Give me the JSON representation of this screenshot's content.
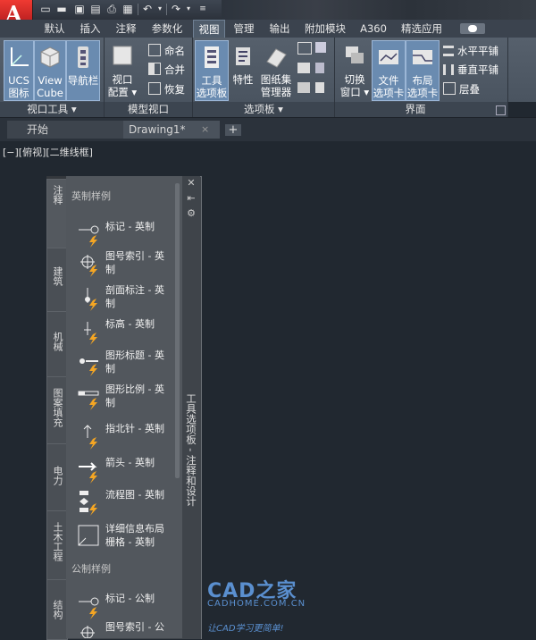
{
  "quick_access": {
    "icons": [
      "new-icon",
      "open-icon",
      "save-icon",
      "saveas-icon",
      "print-icon",
      "undo-icon",
      "redo-icon",
      "customize-icon"
    ]
  },
  "ribbon_tabs": [
    "默认",
    "插入",
    "注释",
    "参数化",
    "视图",
    "管理",
    "输出",
    "附加模块",
    "A360",
    "精选应用"
  ],
  "active_tab": "视图",
  "panels": {
    "viewport_tools": {
      "label": "视口工具",
      "buttons": [
        {
          "line1": "UCS",
          "line2": "图标"
        },
        {
          "line1": "View",
          "line2": "Cube"
        },
        {
          "line1": "导航栏",
          "line2": ""
        }
      ]
    },
    "model_viewports": {
      "label": "模型视口",
      "config_line1": "视口",
      "config_line2": "配置",
      "small": [
        "命名",
        "合并",
        "恢复"
      ]
    },
    "palettes": {
      "label": "选项板",
      "tool_palettes_line1": "工具",
      "tool_palettes_line2": "选项板",
      "properties": "特性",
      "sheetset_line1": "图纸集",
      "sheetset_line2": "管理器"
    },
    "interface": {
      "label": "界面",
      "switch_line1": "切换",
      "switch_line2": "窗口",
      "file_tabs_line1": "文件",
      "file_tabs_line2": "选项卡",
      "layout_tabs_line1": "布局",
      "layout_tabs_line2": "选项卡",
      "small": [
        "水平平铺",
        "垂直平铺",
        "层叠"
      ]
    }
  },
  "doc_tabs": {
    "start": "开始",
    "drawing": "Drawing1*",
    "close": "×",
    "add": "+"
  },
  "viewport_label": "[−][俯视][二维线框]",
  "palette": {
    "title": "工具选项板 - 注释和设计",
    "vertical_tabs": [
      "注释",
      "建筑",
      "机械",
      "图案填充",
      "电力",
      "土木工程",
      "结构"
    ],
    "controls": [
      "✕",
      "⇤",
      "⚙"
    ],
    "section1": "英制样例",
    "section2": "公制样例",
    "tools_imperial": [
      {
        "line1": "标记 - 英制",
        "line2": ""
      },
      {
        "line1": "图号索引 - 英",
        "line2": "制"
      },
      {
        "line1": "剖面标注 - 英",
        "line2": "制"
      },
      {
        "line1": "标高 - 英制",
        "line2": ""
      },
      {
        "line1": "图形标题 - 英",
        "line2": "制"
      },
      {
        "line1": "图形比例 - 英",
        "line2": "制"
      },
      {
        "line1": "指北针 - 英制",
        "line2": ""
      },
      {
        "line1": "箭头 - 英制",
        "line2": ""
      },
      {
        "line1": "流程图 - 英制",
        "line2": ""
      },
      {
        "line1": "详细信息布局",
        "line2": "栅格 - 英制"
      }
    ],
    "tools_metric": [
      {
        "line1": "标记 - 公制",
        "line2": ""
      },
      {
        "line1": "图号索引 - 公",
        "line2": ""
      }
    ]
  },
  "watermark": {
    "brand": "CAD之家",
    "url": "CADHOME.COM.CN",
    "slogan": "让CAD学习更简单!"
  },
  "colors": {
    "background": "#212830",
    "ribbon": "#4f5965",
    "active_tab": "#4f5c6b",
    "selected_button": "#6a8bb0",
    "brand_red": "#d9272e",
    "watermark_blue": "#5a8fcf"
  }
}
